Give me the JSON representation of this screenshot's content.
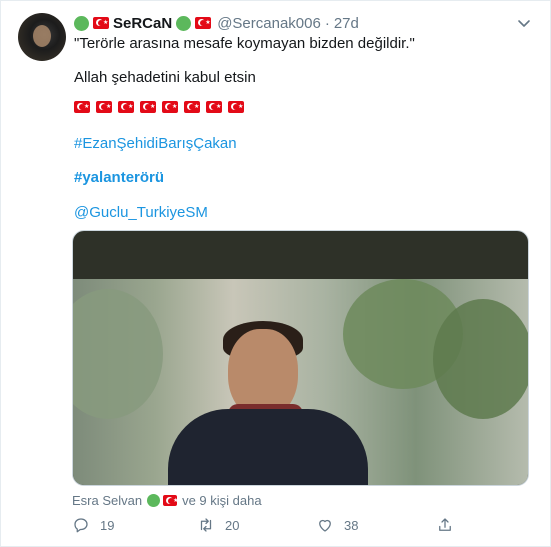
{
  "tweet": {
    "display_name": "SeRCaN",
    "handle": "@Sercanak006",
    "separator": "·",
    "time": "27d",
    "text_line1": "\"Terörle arasına mesafe koymayan bizden değildir.\"",
    "text_line2": "Allah şehadetini kabul etsin",
    "flag_count": 8,
    "hashtag1": "#EzanŞehidiBarışÇakan",
    "hashtag2": "#yalanterörü",
    "mention": "@Guclu_TurkiyeSM"
  },
  "social_context": {
    "name": "Esra Selvan",
    "suffix": "ve 9 kişi daha"
  },
  "actions": {
    "reply_count": "19",
    "retweet_count": "20",
    "like_count": "38"
  },
  "colors": {
    "link": "#1b95e0",
    "secondary_text": "#657786",
    "flag_red": "#e30a17",
    "status_green": "#5cb85c"
  },
  "icons": [
    "reply-icon",
    "retweet-icon",
    "like-icon",
    "share-icon",
    "chevron-down-icon",
    "green-circle-icon",
    "turkey-flag-icon"
  ]
}
